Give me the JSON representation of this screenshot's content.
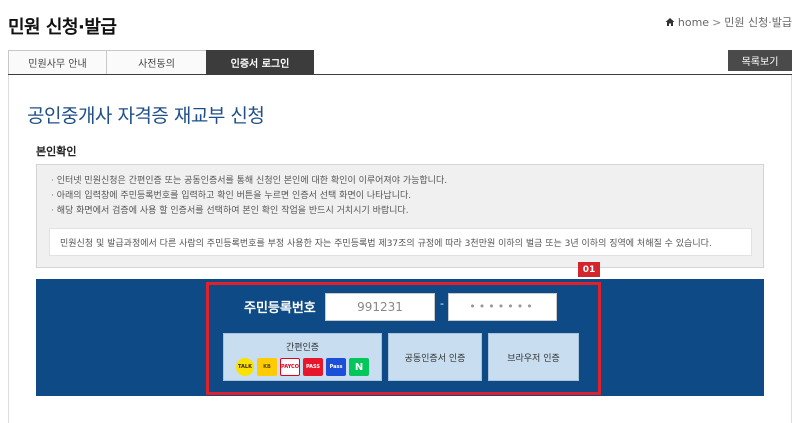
{
  "header": {
    "title": "민원 신청·발급",
    "breadcrumb": {
      "home": "home",
      "sep": ">",
      "current": "민원 신청·발급"
    }
  },
  "tabs": [
    {
      "label": "민원사무 안내"
    },
    {
      "label": "사전동의"
    },
    {
      "label": "인증서 로그인",
      "active": true
    }
  ],
  "list_button": "목록보기",
  "main": {
    "title": "공인중개사 자격증 재교부 신청",
    "section_heading": "본인확인",
    "notices": [
      "인터넷 민원신청은 간편인증 또는 공동인증서를 통해 신청인 본인에 대한 확인이 이루어져야 가능합니다.",
      "아래의 입력창에 주민등록번호를 입력하고 확인 버튼을 누르면 인증서 선택 화면이 나타납니다.",
      "해당 화면에서 검증에 사용 할 인증서를 선택하여 본인 확인 작업을 반드시 거치시기 바랍니다."
    ],
    "warning": "민원신청 및 발급과정에서 다른 사람의 주민등록번호를 부정 사용한 자는 주민등록법 제37조의 규정에 따라 3천만원 이하의 벌금 또는 3년 이하의 징역에 처해질 수 있습니다."
  },
  "auth": {
    "step_badge": "01",
    "rrn_label": "주민등록번호",
    "rrn_front_value": "991231",
    "rrn_dash": "-",
    "rrn_back_value": "•••••••",
    "simple_auth_label": "간편인증",
    "providers": [
      {
        "name": "kakao-icon",
        "text": "TALK"
      },
      {
        "name": "kb-icon",
        "text": "KB"
      },
      {
        "name": "payco-icon",
        "text": "PAYCO"
      },
      {
        "name": "pass-icon",
        "text": "PASS"
      },
      {
        "name": "samsung-pass-icon",
        "text": "Pass"
      },
      {
        "name": "naver-icon",
        "text": "N"
      }
    ],
    "cert_auth_label": "공동인증서 인증",
    "browser_auth_label": "브라우저 인증"
  },
  "colors": {
    "title_blue": "#1f4f88",
    "panel_blue": "#0e4a86",
    "highlight_red": "#e0202a",
    "button_light_blue": "#c8def0"
  }
}
